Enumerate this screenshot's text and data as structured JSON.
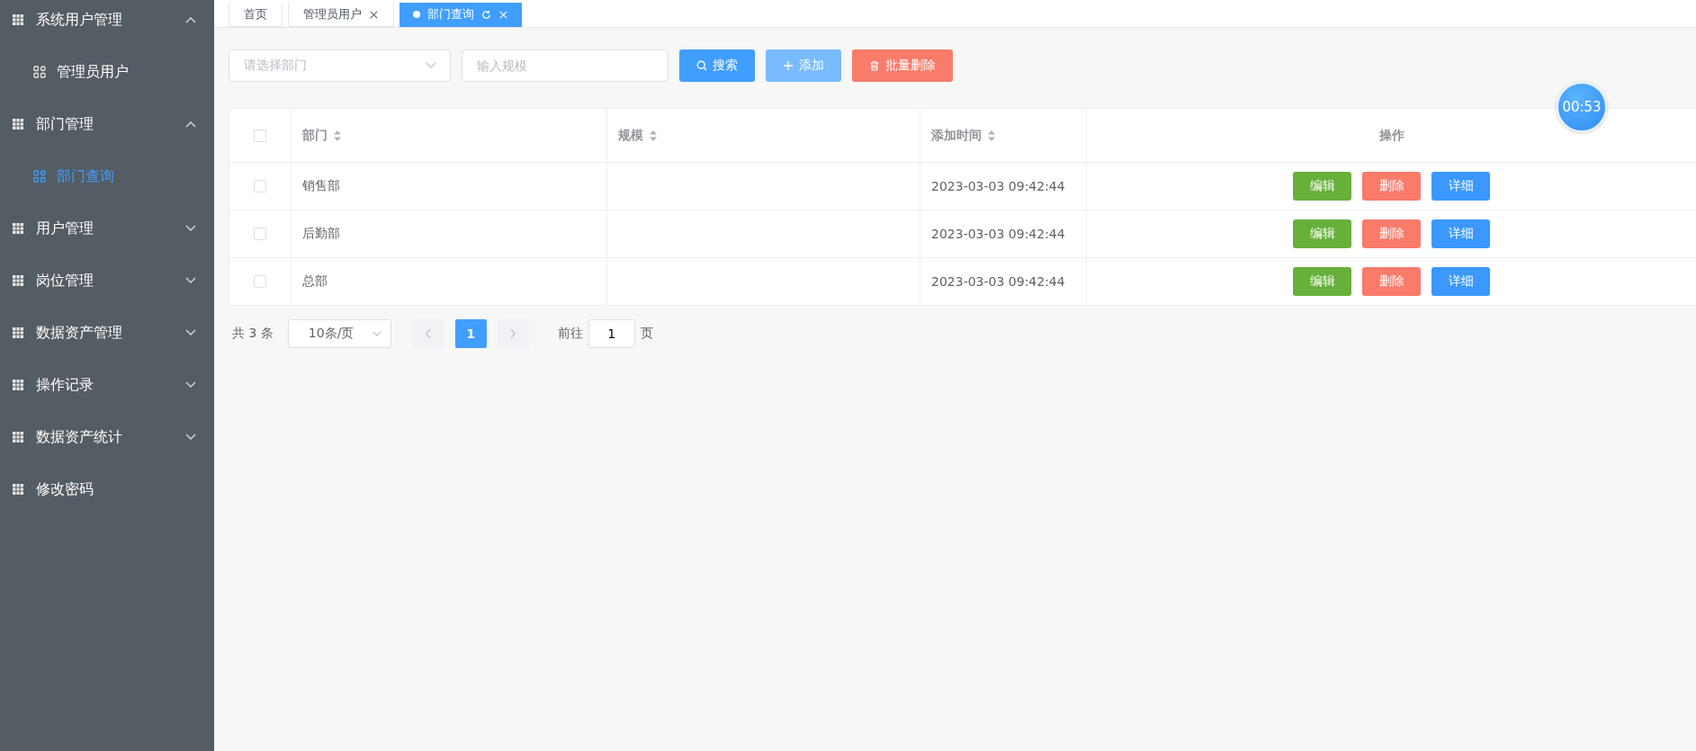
{
  "sidebar": {
    "items": [
      {
        "label": "系统用户管理",
        "expanded": true,
        "children": [
          {
            "label": "管理员用户",
            "selected": false
          }
        ]
      },
      {
        "label": "部门管理",
        "expanded": true,
        "children": [
          {
            "label": "部门查询",
            "selected": true
          }
        ]
      },
      {
        "label": "用户管理",
        "expanded": false
      },
      {
        "label": "岗位管理",
        "expanded": false
      },
      {
        "label": "数据资产管理",
        "expanded": false
      },
      {
        "label": "操作记录",
        "expanded": false
      },
      {
        "label": "数据资产统计",
        "expanded": false
      },
      {
        "label": "修改密码"
      }
    ]
  },
  "tabs": [
    {
      "label": "首页",
      "selected": false,
      "closable": false
    },
    {
      "label": "管理员用户",
      "selected": false,
      "closable": true
    },
    {
      "label": "部门查询",
      "selected": true,
      "closable": true
    }
  ],
  "filters": {
    "department": {
      "placeholder": "请选择部门"
    },
    "scale": {
      "placeholder": "输入规模"
    }
  },
  "toolbar": [
    {
      "label": "搜索",
      "kind": "search",
      "hovered": false
    },
    {
      "label": "添加",
      "kind": "add",
      "hovered": true
    },
    {
      "label": "批量删除",
      "kind": "delete",
      "hovered": false
    }
  ],
  "table": {
    "columns": [
      {
        "label": "部门",
        "sortable": true
      },
      {
        "label": "规模",
        "sortable": true
      },
      {
        "label": "添加时间",
        "sortable": true
      },
      {
        "label": "操作",
        "sortable": false
      }
    ],
    "header_checked": false,
    "rows": [
      {
        "checked": false,
        "cells": [
          "销售部",
          "",
          "2023-03-03 09:42:44"
        ],
        "actions": [
          {
            "label": "编辑",
            "kind": "edit"
          },
          {
            "label": "删除",
            "kind": "delete"
          },
          {
            "label": "详细",
            "kind": "detail"
          }
        ]
      },
      {
        "checked": false,
        "cells": [
          "后勤部",
          "",
          "2023-03-03 09:42:44"
        ],
        "actions": [
          {
            "label": "编辑",
            "kind": "edit"
          },
          {
            "label": "删除",
            "kind": "delete"
          },
          {
            "label": "详细",
            "kind": "detail"
          }
        ]
      },
      {
        "checked": false,
        "cells": [
          "总部",
          "",
          "2023-03-03 09:42:44"
        ],
        "actions": [
          {
            "label": "编辑",
            "kind": "edit"
          },
          {
            "label": "删除",
            "kind": "delete"
          },
          {
            "label": "详细",
            "kind": "detail"
          }
        ]
      }
    ]
  },
  "pagination": {
    "total": "共 3 条",
    "page_size": "10条/页",
    "pages": [
      {
        "label": "1",
        "selected": true
      }
    ],
    "goto_label": "前往",
    "goto_value": "1",
    "goto_suffix": "页"
  },
  "timer": "00:53"
}
